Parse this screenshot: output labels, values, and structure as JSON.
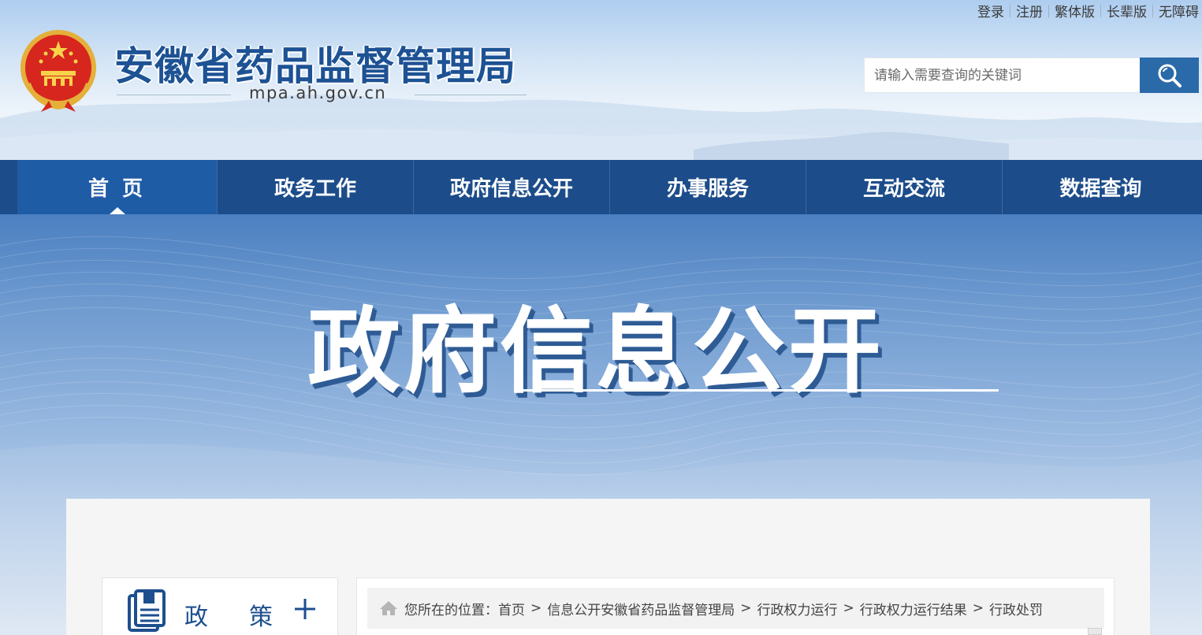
{
  "header": {
    "top_links": [
      "登录",
      "注册",
      "繁体版",
      "长辈版",
      "无障碍"
    ],
    "site_title": "安徽省药品监督管理局",
    "domain": "mpa.ah.gov.cn",
    "search": {
      "placeholder": "请输入需要查询的关键词",
      "icon": "search-icon"
    },
    "emblem_icon": "national-emblem-icon"
  },
  "nav": {
    "items": [
      "首 页",
      "政务工作",
      "政府信息公开",
      "办事服务",
      "互动交流",
      "数据查询"
    ],
    "active_index": 0
  },
  "banner": {
    "title": "政府信息公开"
  },
  "sidebar": {
    "label": "政策",
    "icon": "document-list-icon",
    "toggle_icon": "plus-icon"
  },
  "breadcrumb": {
    "prefix": "您所在的位置：",
    "items": [
      "首页",
      "信息公开安徽省药品监督管理局",
      "行政权力运行",
      "行政权力运行结果",
      "行政处罚"
    ],
    "separator": ">",
    "home_icon": "home-icon"
  },
  "colors": {
    "brand_blue": "#1d5294",
    "nav_bg": "#1c4c8a",
    "nav_active": "#1f5ca6",
    "search_button": "#2a6aa8"
  }
}
